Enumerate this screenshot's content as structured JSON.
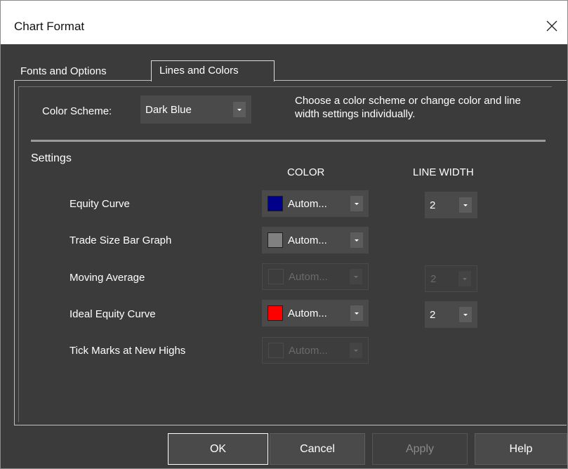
{
  "window": {
    "title": "Chart Format",
    "close_label": "✕"
  },
  "tabs": [
    {
      "label": "Fonts and Options",
      "selected": false
    },
    {
      "label": "Lines and Colors",
      "selected": true
    }
  ],
  "color_scheme": {
    "label": "Color Scheme:",
    "value": "Dark Blue",
    "hint": "Choose a color scheme or change color and line width settings individually."
  },
  "settings": {
    "heading": "Settings",
    "color_header": "COLOR",
    "width_header": "LINE WIDTH",
    "rows": [
      {
        "label": "Equity Curve",
        "color_value": "Autom...",
        "swatch": "#00008b",
        "color_enabled": true,
        "width_value": "2",
        "width_enabled": true
      },
      {
        "label": "Trade Size Bar Graph",
        "color_value": "Autom...",
        "swatch": "#808080",
        "color_enabled": true,
        "width_value": null,
        "width_enabled": null
      },
      {
        "label": "Moving Average",
        "color_value": "Autom...",
        "swatch": null,
        "color_enabled": false,
        "width_value": "2",
        "width_enabled": false
      },
      {
        "label": "Ideal Equity Curve",
        "color_value": "Autom...",
        "swatch": "#ff0000",
        "color_enabled": true,
        "width_value": "2",
        "width_enabled": true
      },
      {
        "label": "Tick Marks at New Highs",
        "color_value": "Autom...",
        "swatch": null,
        "color_enabled": false,
        "width_value": null,
        "width_enabled": null
      }
    ]
  },
  "buttons": {
    "ok": "OK",
    "cancel": "Cancel",
    "apply": "Apply",
    "help": "Help"
  }
}
